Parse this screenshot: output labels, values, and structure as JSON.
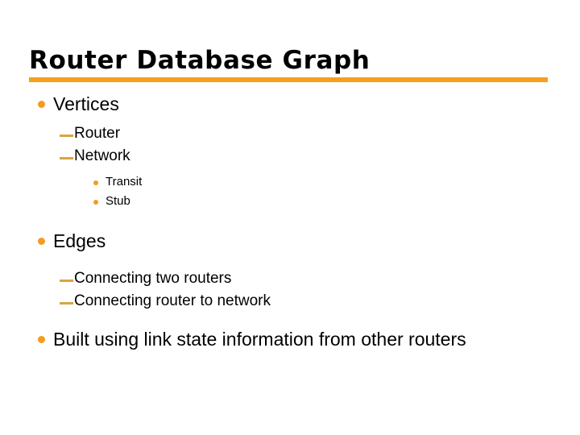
{
  "slide": {
    "title": "Router Database Graph",
    "accent_color": "#F5A01C",
    "bullet_color": "#F59B1E",
    "dash_color": "#D9A441",
    "text_color": "#000000",
    "background_color": "#FFFFFF",
    "outline": [
      {
        "level": 1,
        "marker": "round-bullet",
        "text": "Vertices"
      },
      {
        "level": 2,
        "marker": "em-dash",
        "text": "Router"
      },
      {
        "level": 2,
        "marker": "em-dash",
        "text": "Network"
      },
      {
        "level": 3,
        "marker": "small-round-bullet",
        "text": "Transit"
      },
      {
        "level": 3,
        "marker": "small-round-bullet",
        "text": "Stub"
      },
      {
        "level": 1,
        "marker": "round-bullet",
        "text": "Edges"
      },
      {
        "level": 2,
        "marker": "em-dash",
        "text": "Connecting two routers"
      },
      {
        "level": 2,
        "marker": "em-dash",
        "text": "Connecting router to network"
      },
      {
        "level": 1,
        "marker": "round-bullet",
        "text": "Built using link state information from other routers"
      }
    ]
  }
}
